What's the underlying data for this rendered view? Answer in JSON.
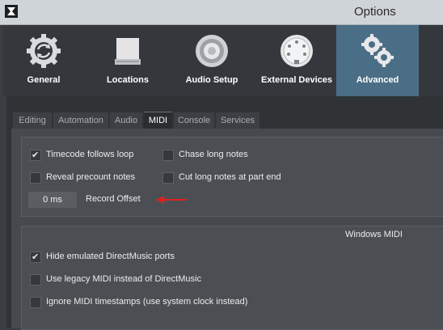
{
  "window": {
    "title": "Options"
  },
  "toolbar": {
    "items": [
      {
        "label": "General",
        "icon": "gear-refresh-icon"
      },
      {
        "label": "Locations",
        "icon": "drive-icon"
      },
      {
        "label": "Audio Setup",
        "icon": "speaker-icon"
      },
      {
        "label": "External Devices",
        "icon": "midi-connector-icon"
      },
      {
        "label": "Advanced",
        "icon": "gears-icon",
        "active": true
      }
    ]
  },
  "tabs": [
    {
      "label": "Editing"
    },
    {
      "label": "Automation"
    },
    {
      "label": "Audio"
    },
    {
      "label": "MIDI",
      "active": true
    },
    {
      "label": "Console"
    },
    {
      "label": "Services"
    }
  ],
  "midi": {
    "timecode_follows_loop": {
      "label": "Timecode follows loop",
      "checked": true
    },
    "chase_long_notes": {
      "label": "Chase long notes",
      "checked": false
    },
    "reveal_precount_notes": {
      "label": "Reveal precount notes",
      "checked": false
    },
    "cut_long_notes": {
      "label": "Cut long notes at part end",
      "checked": false
    },
    "record_offset": {
      "value": "0 ms",
      "label": "Record Offset"
    }
  },
  "windows_midi": {
    "heading": "Windows MIDI",
    "hide_emulated": {
      "label": "Hide emulated DirectMusic ports",
      "checked": true
    },
    "use_legacy": {
      "label": "Use legacy MIDI instead of DirectMusic",
      "checked": false
    },
    "ignore_timestamps": {
      "label": "Ignore MIDI timestamps (use system clock instead)",
      "checked": false
    }
  },
  "colors": {
    "accent": "#4a6e86",
    "annotation_arrow": "#e02020"
  }
}
